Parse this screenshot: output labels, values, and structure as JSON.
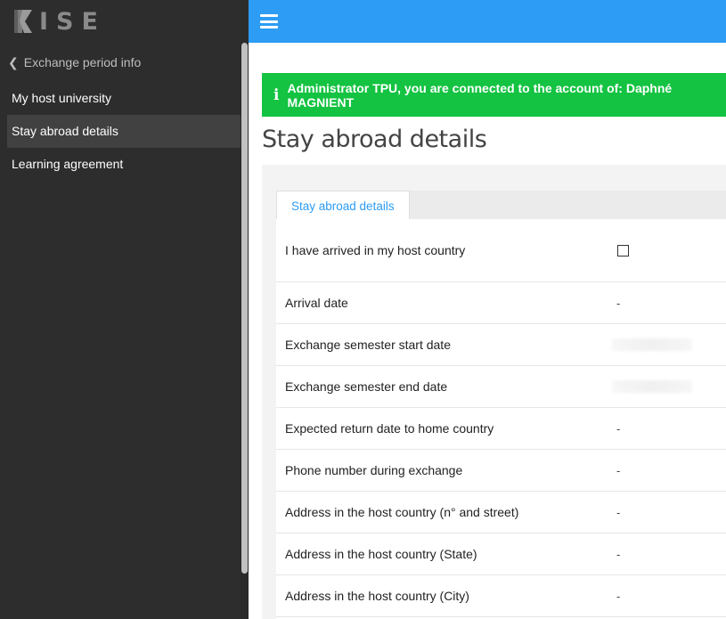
{
  "logo": {
    "text": "ISE",
    "brand_color": "#2d9cf4"
  },
  "header": {
    "menu_icon": "hamburger-icon"
  },
  "sidebar": {
    "back_label": "Exchange period info",
    "items": [
      {
        "label": "My host university",
        "active": false
      },
      {
        "label": "Stay abroad details",
        "active": true
      },
      {
        "label": "Learning agreement",
        "active": false
      }
    ]
  },
  "alert": {
    "icon": "info-icon",
    "text": "Administrator TPU, you are connected to the account of: Daphné MAGNIENT",
    "color": "#13c341"
  },
  "page": {
    "title": "Stay abroad details"
  },
  "tabs": [
    {
      "label": "Stay abroad details",
      "active": true
    }
  ],
  "details": {
    "rows": [
      {
        "label": "I have arrived in my host country",
        "value": "",
        "type": "checkbox",
        "checked": false
      },
      {
        "label": "Arrival date",
        "value": "-"
      },
      {
        "label": "Exchange semester start date",
        "value": "",
        "type": "redacted"
      },
      {
        "label": "Exchange semester end date",
        "value": "",
        "type": "redacted"
      },
      {
        "label": "Expected return date to home country",
        "value": "-"
      },
      {
        "label": "Phone number during exchange",
        "value": "-"
      },
      {
        "label": "Address in the host country (n° and street)",
        "value": "-"
      },
      {
        "label": "Address in the host country (State)",
        "value": "-"
      },
      {
        "label": "Address in the host country (City)",
        "value": "-"
      }
    ]
  }
}
